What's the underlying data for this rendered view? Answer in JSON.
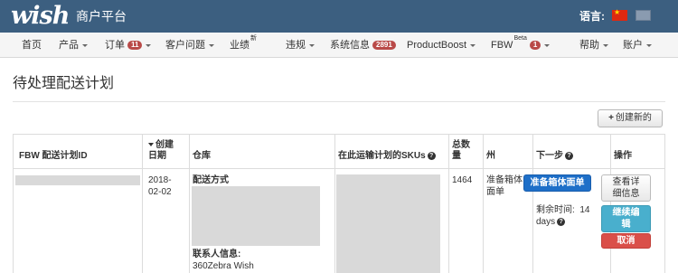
{
  "header": {
    "logo": "wish",
    "platform_name": "商户平台",
    "language_label": "语言:",
    "languages": [
      "chinese-flag-icon",
      "us-flag-icon"
    ]
  },
  "nav": {
    "home": "首页",
    "products": "产品",
    "orders": "订单",
    "orders_badge": "11",
    "customer_issues": "客户问题",
    "performance": "业绩",
    "performance_sup": "新",
    "violations": "违规",
    "system_info": "系统信息",
    "system_info_badge": "2891",
    "productboost": "ProductBoost",
    "fbw": "FBW",
    "fbw_sup": "Beta",
    "fbw_badge": "1",
    "help": "帮助",
    "account": "账户"
  },
  "page": {
    "title": "待处理配送计划",
    "create_button": "创建新的"
  },
  "table": {
    "headers": {
      "plan_id": "FBW 配送计划ID",
      "created_date_line1": "创建",
      "created_date_line2": "日期",
      "warehouse": "仓库",
      "skus": "在此运输计划的SKUs",
      "total_line1": "总数",
      "total_line2": "量",
      "state": "州",
      "next_step": "下一步",
      "actions": "操作"
    },
    "rows": [
      {
        "created_date_line1": "2018-",
        "created_date_line2": "02-02",
        "shipping_method_label": "配送方式",
        "contact_label": "联系人信息:",
        "contact_value": "360Zebra Wish",
        "total": "1464",
        "state_line1": "准备箱体",
        "state_line2": "面单",
        "next_step_button": "准备箱体面单",
        "remaining_time_label": "剩余时间:",
        "remaining_time_value": "14",
        "remaining_time_unit": "days",
        "view_details_line1": "查看详",
        "view_details_line2": "细信息",
        "continue_edit_line1": "继续编",
        "continue_edit_line2": "辑",
        "cancel": "取消"
      }
    ]
  },
  "colors": {
    "header_bg": "#3c5f80",
    "primary_button": "#1e6fc8",
    "info_button": "#49afcd",
    "danger_button": "#da4f49",
    "badge": "#b94a48"
  }
}
